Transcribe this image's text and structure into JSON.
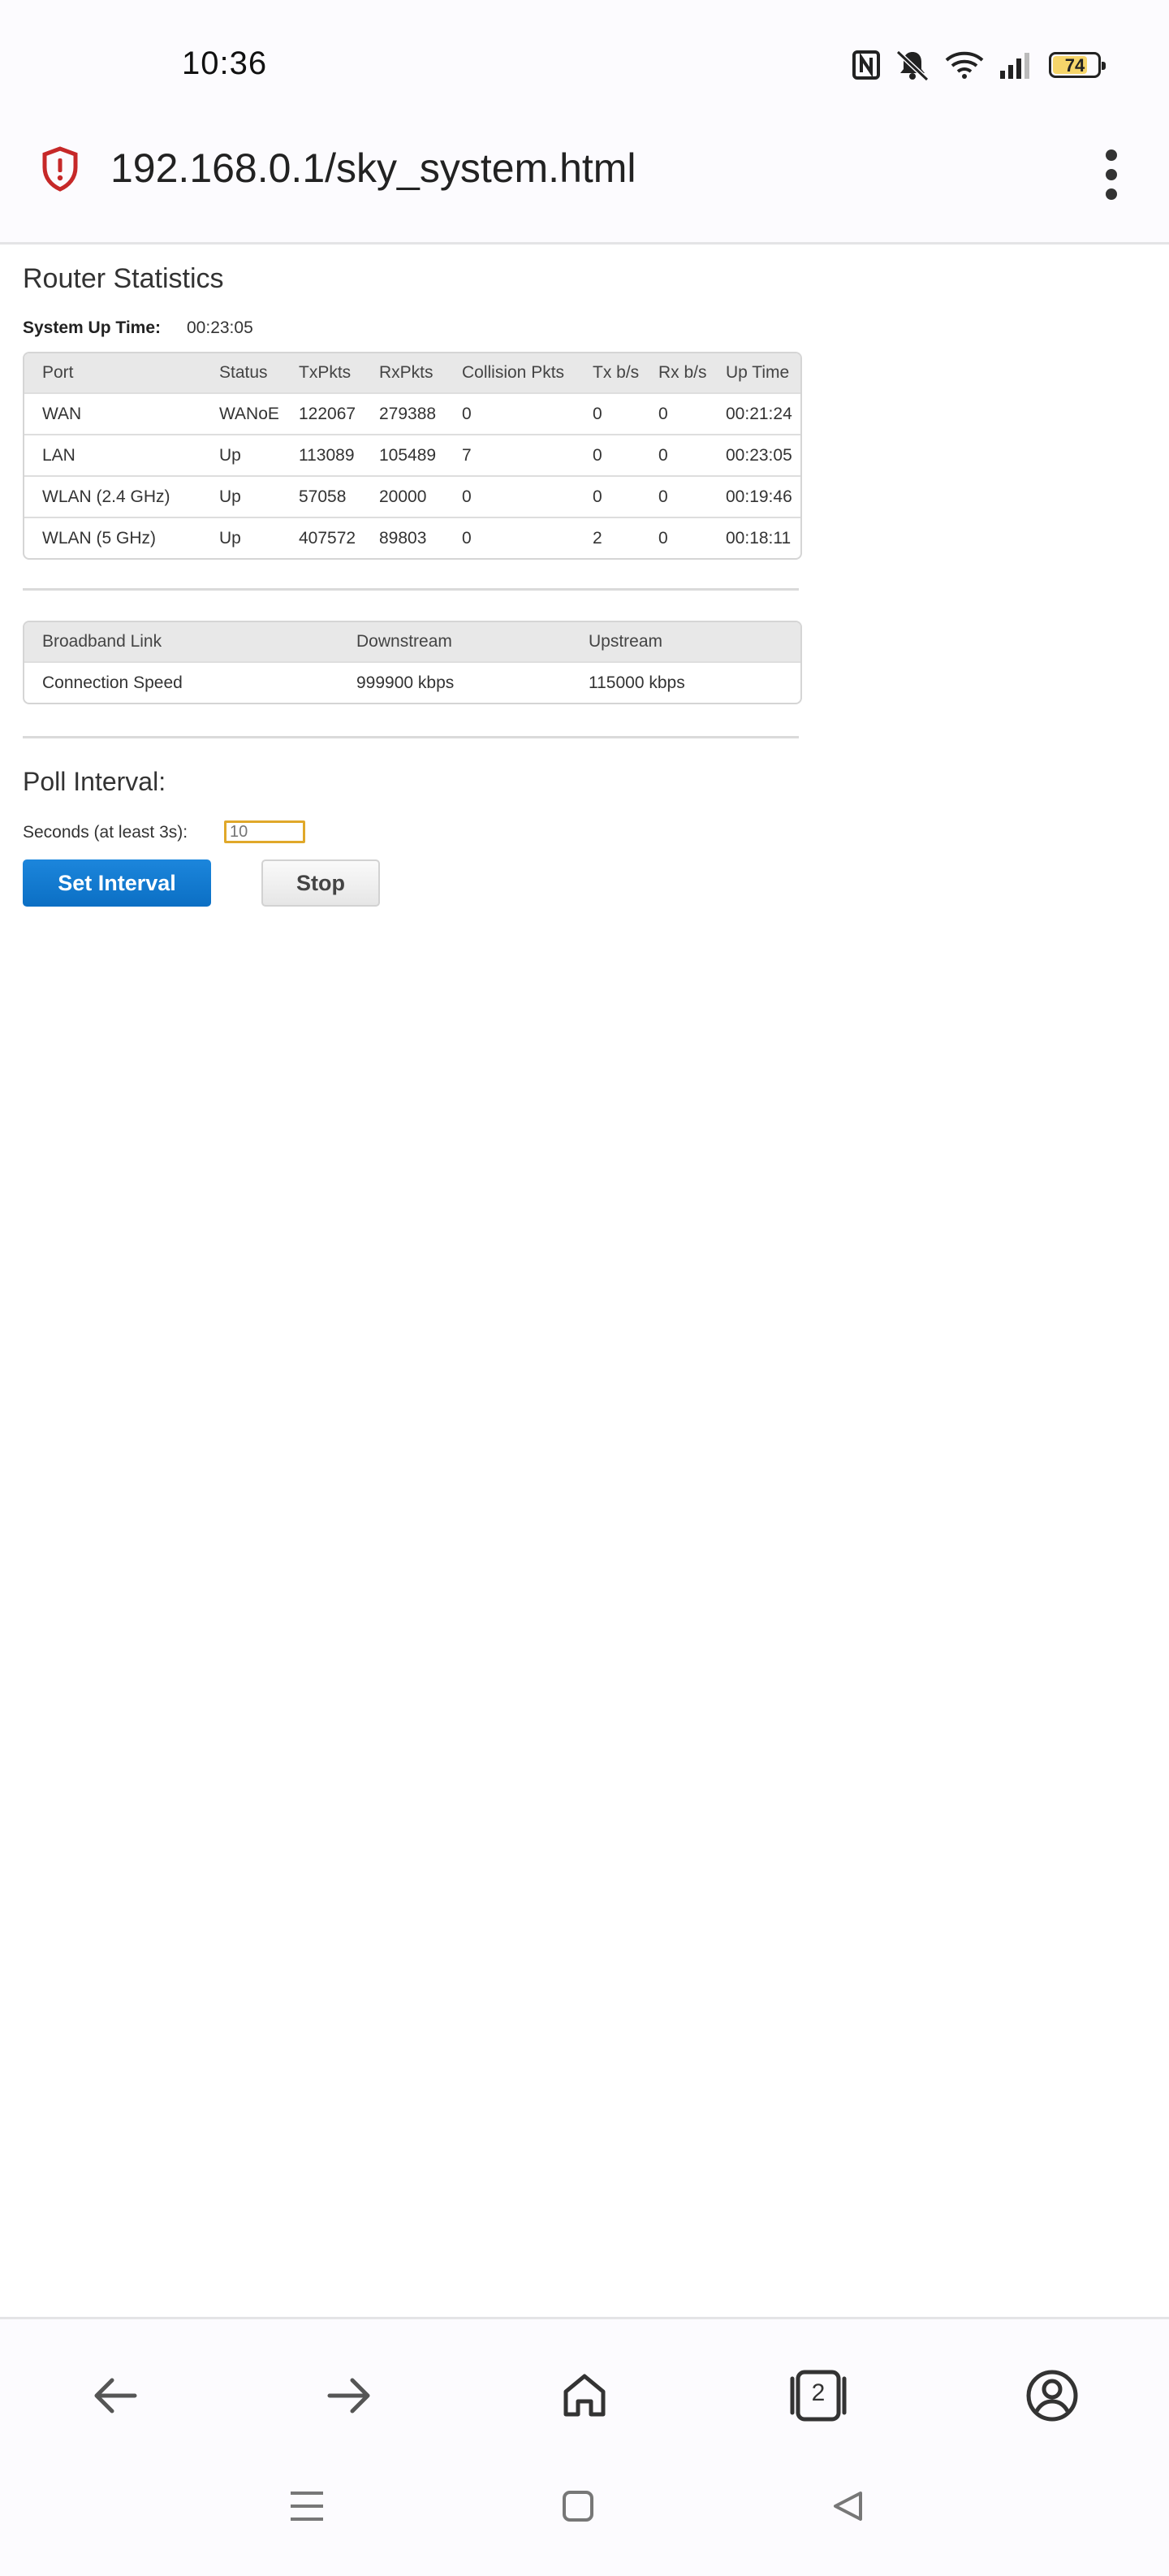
{
  "status_bar": {
    "time": "10:36",
    "battery": "74",
    "icons": [
      "nfc-icon",
      "mute-bell-icon",
      "wifi-icon",
      "signal-icon",
      "battery-icon"
    ]
  },
  "browser": {
    "url": "192.168.0.1/sky_system.html",
    "security_icon": "shield-alert-icon",
    "menu_icon": "more-vert-icon",
    "open_tabs": "2"
  },
  "page": {
    "title": "Router Statistics",
    "uptime_label": "System Up Time:",
    "uptime_value": "00:23:05",
    "stats_table": {
      "headers": [
        "Port",
        "Status",
        "TxPkts",
        "RxPkts",
        "Collision Pkts",
        "Tx b/s",
        "Rx b/s",
        "Up Time"
      ],
      "rows": [
        [
          "WAN",
          "WANoE",
          "122067",
          "279388",
          "0",
          "0",
          "0",
          "00:21:24"
        ],
        [
          "LAN",
          "Up",
          "113089",
          "105489",
          "7",
          "0",
          "0",
          "00:23:05"
        ],
        [
          "WLAN (2.4 GHz)",
          "Up",
          "57058",
          "20000",
          "0",
          "0",
          "0",
          "00:19:46"
        ],
        [
          "WLAN (5 GHz)",
          "Up",
          "407572",
          "89803",
          "0",
          "2",
          "0",
          "00:18:11"
        ]
      ]
    },
    "broadband_table": {
      "headers": [
        "Broadband Link",
        "Downstream",
        "Upstream"
      ],
      "rows": [
        [
          "Connection Speed",
          "999900 kbps",
          "115000 kbps"
        ]
      ]
    },
    "poll": {
      "title": "Poll Interval:",
      "label": "Seconds (at least 3s):",
      "placeholder": "10",
      "set_label": "Set Interval",
      "stop_label": "Stop"
    }
  },
  "colors": {
    "primary_button": "#0b6fc4",
    "input_focus": "#e0a82a",
    "shield": "#c62828",
    "battery_fill": "#f6d56a"
  }
}
